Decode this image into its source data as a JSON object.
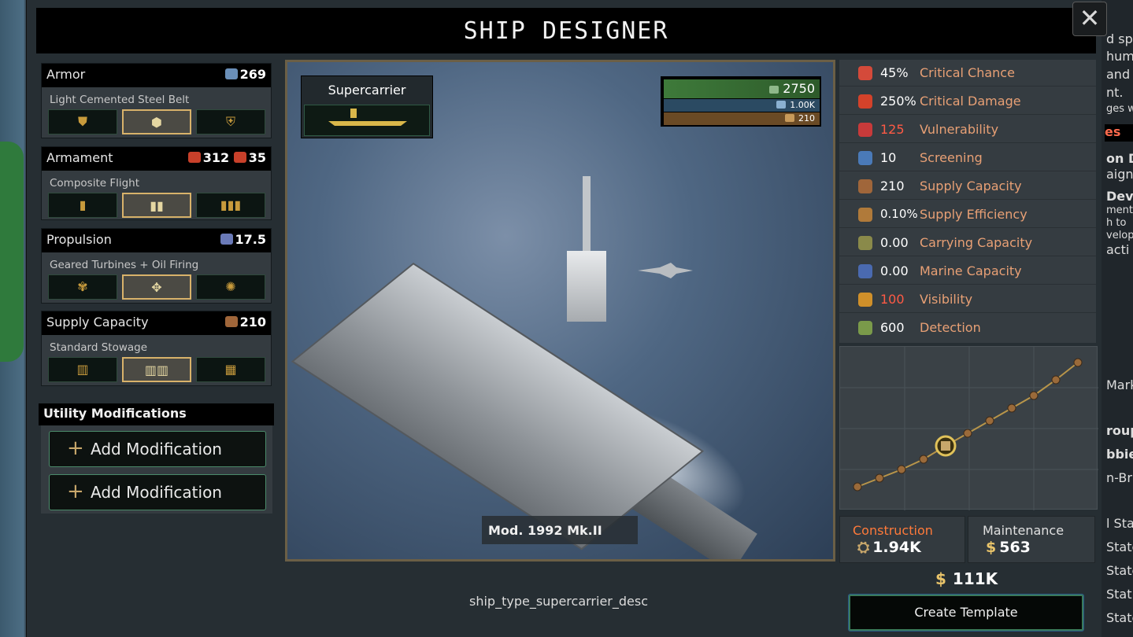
{
  "window": {
    "title": "SHIP DESIGNER",
    "close_glyph": "✕"
  },
  "ship": {
    "type": "Supercarrier",
    "variant": "Mod. 1992 Mk.II",
    "description_key": "ship_type_supercarrier_desc"
  },
  "bars": {
    "manpower": "2750",
    "armor": "1.00K",
    "supply": "210"
  },
  "modules": [
    {
      "title": "Armor",
      "value": "269",
      "icon": "armor-plate-icon",
      "subtitle": "Light Cemented Steel Belt",
      "selected_index": 1,
      "options": [
        "shield-icon",
        "armor-layers-icon",
        "heavy-armor-icon"
      ]
    },
    {
      "title": "Armament",
      "value1": "312",
      "value2": "35",
      "icon": "explosion-icon",
      "subtitle": "Composite Flight",
      "selected_index": 1,
      "options": [
        "single-shell-icon",
        "double-shell-icon",
        "triple-shell-icon"
      ]
    },
    {
      "title": "Propulsion",
      "value": "17.5",
      "icon": "engine-icon",
      "subtitle": "Geared Turbines + Oil Firing",
      "selected_index": 1,
      "options": [
        "propeller-basic-icon",
        "propeller-turbine-icon",
        "propeller-advanced-icon"
      ]
    },
    {
      "title": "Supply Capacity",
      "value": "210",
      "icon": "crate-icon",
      "subtitle": "Standard Stowage",
      "selected_index": 1,
      "options": [
        "single-crate-icon",
        "double-crate-icon",
        "stacked-crates-icon"
      ]
    }
  ],
  "utility": {
    "title": "Utility Modifications",
    "add_label": "Add Modification",
    "slots": 2
  },
  "stats": [
    {
      "value": "45%",
      "label": "Critical Chance",
      "icon": "critical-chance-icon",
      "color": "#d44a3a"
    },
    {
      "value": "250%",
      "label": "Critical Damage",
      "icon": "critical-damage-icon",
      "color": "#d4422a"
    },
    {
      "value": "125",
      "label": "Vulnerability",
      "icon": "heart-icon",
      "color": "#c83a3a",
      "red": true
    },
    {
      "value": "10",
      "label": "Screening",
      "icon": "screening-icon",
      "color": "#4a7ab8"
    },
    {
      "value": "210",
      "label": "Supply Capacity",
      "icon": "crate-icon",
      "color": "#a0663a"
    },
    {
      "value": "0.10%",
      "label": "Supply Efficiency",
      "icon": "barrel-icon",
      "color": "#b07a3a"
    },
    {
      "value": "0.00",
      "label": "Carrying Capacity",
      "icon": "troops-icon",
      "color": "#8a8a4a"
    },
    {
      "value": "0.00",
      "label": "Marine Capacity",
      "icon": "marines-icon",
      "color": "#4a6ab0"
    },
    {
      "value": "100",
      "label": "Visibility",
      "icon": "eye-slash-icon",
      "color": "#d0902a",
      "red": true
    },
    {
      "value": "600",
      "label": "Detection",
      "icon": "binoculars-icon",
      "color": "#7a9a4a"
    }
  ],
  "costs": {
    "construction_label": "Construction",
    "construction_value": "1.94K",
    "maintenance_label": "Maintenance",
    "maintenance_value": "563",
    "currency": "$",
    "total": "111K"
  },
  "actions": {
    "create_template": "Create Template"
  },
  "colors": {
    "accent_gold": "#c8a76b",
    "stat_label": "#e8a075",
    "bad_value": "#ff5a45",
    "button_border": "#3a7a5a"
  },
  "background_right": {
    "lines": [
      "d sp",
      "hum",
      "and",
      "nt.",
      "ges w",
      "es",
      "on D",
      "aign",
      "Deve",
      "ment",
      "h to",
      "velop",
      "acti",
      "Mark",
      "roup",
      "bbie",
      "n-Brit",
      "l Sta",
      "State",
      "State",
      "Stat",
      "State",
      "State"
    ]
  }
}
